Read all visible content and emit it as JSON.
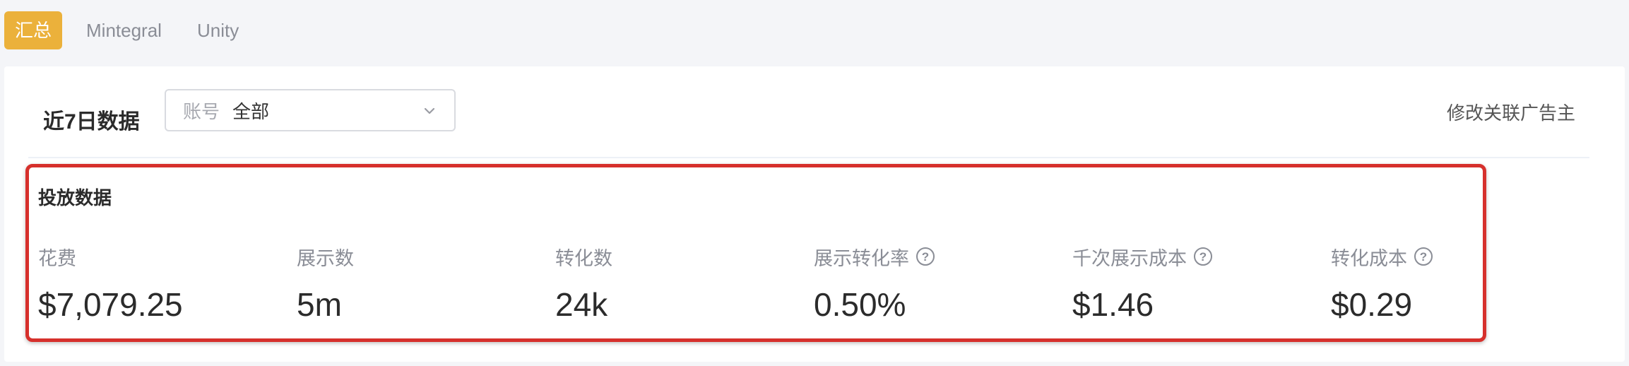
{
  "tabs": [
    {
      "label": "汇总",
      "active": true
    },
    {
      "label": "Mintegral",
      "active": false
    },
    {
      "label": "Unity",
      "active": false
    }
  ],
  "panel": {
    "title": "近7日数据",
    "account_select": {
      "label": "账号",
      "value": "全部"
    },
    "edit_link": "修改关联广告主"
  },
  "delivery": {
    "section_title": "投放数据",
    "metrics": [
      {
        "label": "花费",
        "value": "$7,079.25",
        "help": false
      },
      {
        "label": "展示数",
        "value": "5m",
        "help": false
      },
      {
        "label": "转化数",
        "value": "24k",
        "help": false
      },
      {
        "label": "展示转化率",
        "value": "0.50%",
        "help": true
      },
      {
        "label": "千次展示成本",
        "value": "$1.46",
        "help": true
      },
      {
        "label": "转化成本",
        "value": "$0.29",
        "help": true
      }
    ]
  },
  "colors": {
    "accent": "#ebb13b",
    "highlight_border": "#d6302c"
  },
  "icons": {
    "select_arrow": "chevron-down-icon",
    "help": "question-circle-icon"
  }
}
